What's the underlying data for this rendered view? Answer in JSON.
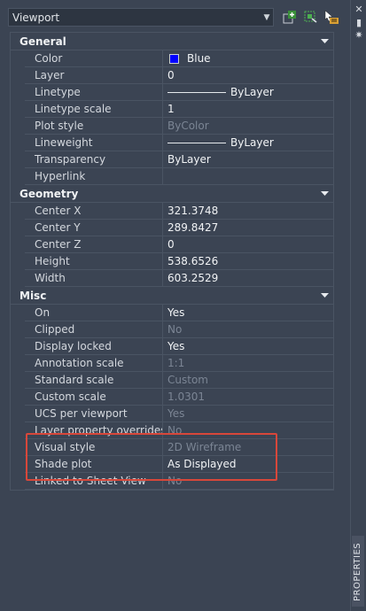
{
  "selector": {
    "value": "Viewport"
  },
  "sections": [
    {
      "name": "General",
      "rows": [
        {
          "label": "Color",
          "value": "Blue",
          "kind": "swatch",
          "swatch_color": "#0000ff"
        },
        {
          "label": "Layer",
          "value": "0"
        },
        {
          "label": "Linetype",
          "value": "ByLayer",
          "kind": "line"
        },
        {
          "label": "Linetype scale",
          "value": "1"
        },
        {
          "label": "Plot style",
          "value": "ByColor",
          "dim": true
        },
        {
          "label": "Lineweight",
          "value": "ByLayer",
          "kind": "line"
        },
        {
          "label": "Transparency",
          "value": "ByLayer"
        },
        {
          "label": "Hyperlink",
          "value": ""
        }
      ]
    },
    {
      "name": "Geometry",
      "rows": [
        {
          "label": "Center X",
          "value": "321.3748"
        },
        {
          "label": "Center Y",
          "value": "289.8427"
        },
        {
          "label": "Center Z",
          "value": "0"
        },
        {
          "label": "Height",
          "value": "538.6526"
        },
        {
          "label": "Width",
          "value": "603.2529"
        }
      ]
    },
    {
      "name": "Misc",
      "rows": [
        {
          "label": "On",
          "value": "Yes"
        },
        {
          "label": "Clipped",
          "value": "No",
          "dim": true
        },
        {
          "label": "Display locked",
          "value": "Yes"
        },
        {
          "label": "Annotation scale",
          "value": "1:1",
          "dim": true
        },
        {
          "label": "Standard scale",
          "value": "Custom",
          "dim": true
        },
        {
          "label": "Custom scale",
          "value": "1.0301",
          "dim": true
        },
        {
          "label": "UCS per viewport",
          "value": "Yes",
          "dim": true
        },
        {
          "label": "Layer property overrides",
          "value": "No",
          "dim": true
        },
        {
          "label": "Visual style",
          "value": "2D Wireframe",
          "dim": true
        },
        {
          "label": "Shade plot",
          "value": "As Displayed"
        },
        {
          "label": "Linked to Sheet View",
          "value": "No",
          "dim": true
        }
      ]
    }
  ],
  "side_tab": {
    "label": "PROPERTIES"
  },
  "colors": {
    "highlight": "#d8473a",
    "panel": "#3b4453"
  }
}
